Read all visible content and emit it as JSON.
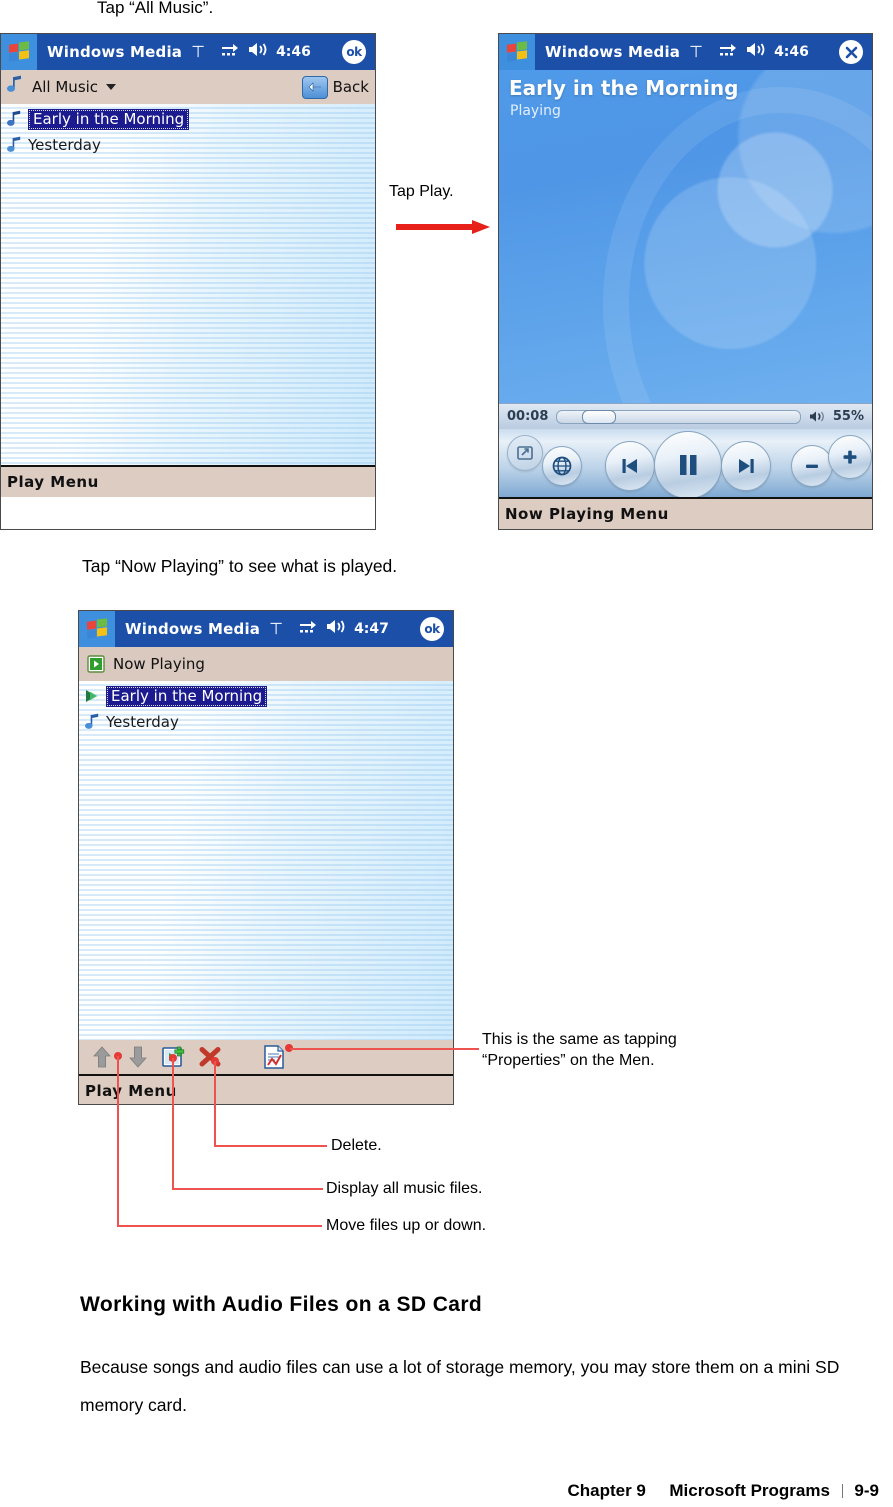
{
  "page": {
    "instruction_top": "Tap “All Music”.",
    "instruction_mid": "Tap “Now Playing” to see what is played.",
    "section_heading": "Working with Audio Files on a SD Card",
    "body_paragraph": "Because songs and audio files can use a lot of storage memory, you may store them on a mini SD memory card.",
    "footer": {
      "chapter": "Chapter 9",
      "title": "Microsoft Programs",
      "page_number": "9-9"
    }
  },
  "annotations": {
    "tap_play": "Tap Play.",
    "properties_note_line1": "This is the same as tapping",
    "properties_note_line2": "“Properties” on the Men.",
    "delete": "Delete.",
    "display_all": "Display all music files.",
    "move_files": "Move files up or down."
  },
  "device_all_music": {
    "titlebar": {
      "app_name": "Windows Media",
      "time": "4:46",
      "ok_label": "ok",
      "icons": [
        "antenna-icon",
        "connectivity-icon",
        "speaker-icon"
      ]
    },
    "command_bar": {
      "label": "All Music",
      "back_label": "Back"
    },
    "list": [
      {
        "label": "Early in the Morning",
        "selected": true,
        "icon": "music-note-icon"
      },
      {
        "label": "Yesterday",
        "selected": false,
        "icon": "music-note-icon"
      }
    ],
    "menu_bar": {
      "label": "Play Menu"
    }
  },
  "device_now_playing": {
    "titlebar": {
      "app_name": "Windows Media",
      "time": "4:46",
      "close_label": "✕",
      "icons": [
        "antenna-icon",
        "connectivity-icon",
        "speaker-icon"
      ]
    },
    "art": {
      "track_title": "Early in the Morning",
      "status": "Playing"
    },
    "transport": {
      "elapsed": "00:08",
      "volume_percent": "55%",
      "seek_position_percent": 10,
      "buttons": [
        "fullscreen-icon",
        "web-globe-icon",
        "previous-icon",
        "pause-icon",
        "next-icon",
        "volume-down-icon",
        "volume-up-icon"
      ]
    },
    "menu_bar": {
      "label": "Now Playing Menu"
    }
  },
  "device_playlist": {
    "titlebar": {
      "app_name": "Windows Media",
      "time": "4:47",
      "ok_label": "ok",
      "icons": [
        "antenna-icon",
        "connectivity-icon",
        "speaker-icon"
      ]
    },
    "command_bar": {
      "label": "Now Playing"
    },
    "list": [
      {
        "label": "Early in the Morning",
        "selected": true,
        "icon": "playing-arrow-icon"
      },
      {
        "label": "Yesterday",
        "selected": false,
        "icon": "music-note-icon"
      }
    ],
    "toolbar_icons": [
      "move-up-icon",
      "move-down-icon",
      "add-files-icon",
      "delete-icon",
      "properties-icon"
    ],
    "menu_bar": {
      "label": "Play Menu"
    }
  },
  "colors": {
    "titlebar_blue": "#1b4fa8",
    "beige_bar": "#ddccc2",
    "selection_navy": "#1b1b8f",
    "annotation_red": "#ef5350",
    "art_blue": "#4f96e6"
  }
}
